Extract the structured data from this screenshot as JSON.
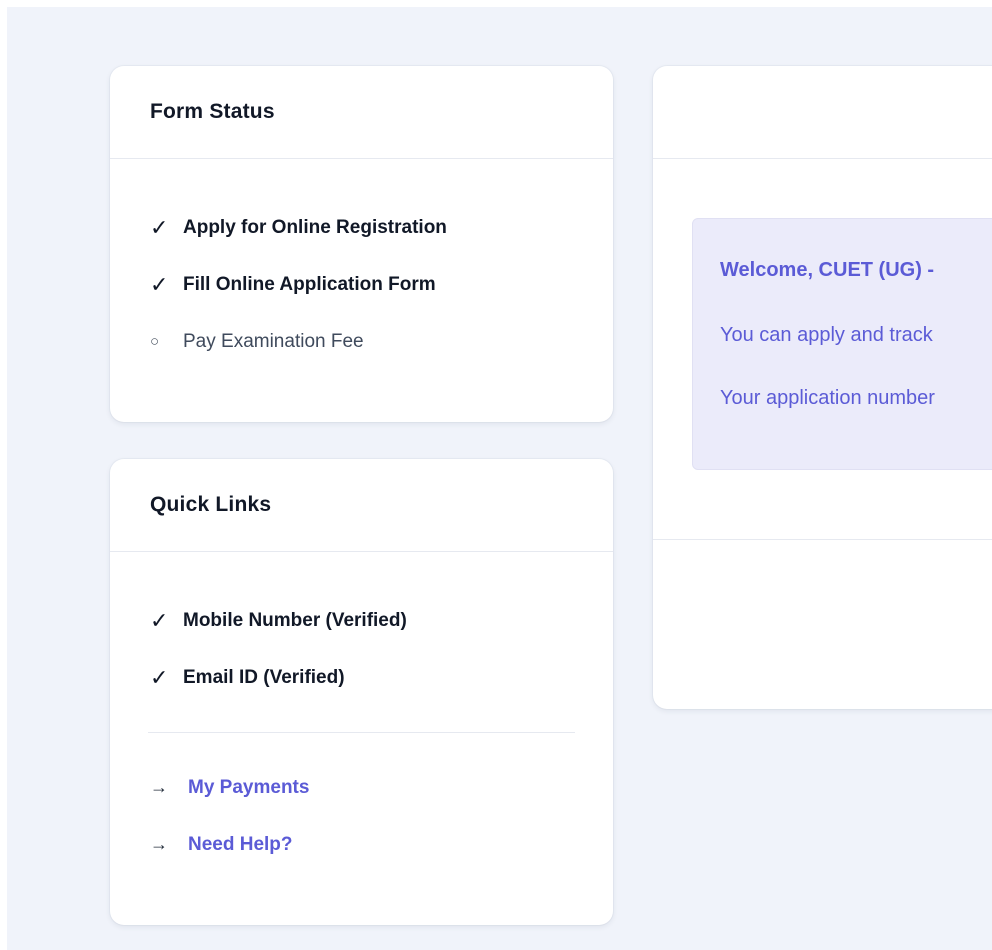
{
  "form_status": {
    "title": "Form Status",
    "items": [
      {
        "mark": "✓",
        "label": "Apply for Online Registration"
      },
      {
        "mark": "✓",
        "label": "Fill Online Application Form"
      },
      {
        "mark": "○",
        "label": "Pay Examination Fee"
      }
    ]
  },
  "quick_links": {
    "title": "Quick Links",
    "verified": [
      {
        "mark": "✓",
        "label": "Mobile Number (Verified)"
      },
      {
        "mark": "✓",
        "label": "Email ID (Verified)"
      }
    ],
    "links": [
      {
        "arrow": "→",
        "label": "My Payments"
      },
      {
        "arrow": "→",
        "label": "Need Help?"
      }
    ]
  },
  "welcome": {
    "title": "Welcome, CUET (UG) -",
    "line1": "You can apply and track",
    "line2": "Your application number"
  },
  "colors": {
    "background": "#f0f3fa",
    "accent": "#5b5bd6",
    "info_box": "#ebebfa",
    "text_dark": "#111827"
  },
  "icons": {
    "done": "check-icon",
    "pending": "circle-icon",
    "link": "arrow-right-icon"
  }
}
